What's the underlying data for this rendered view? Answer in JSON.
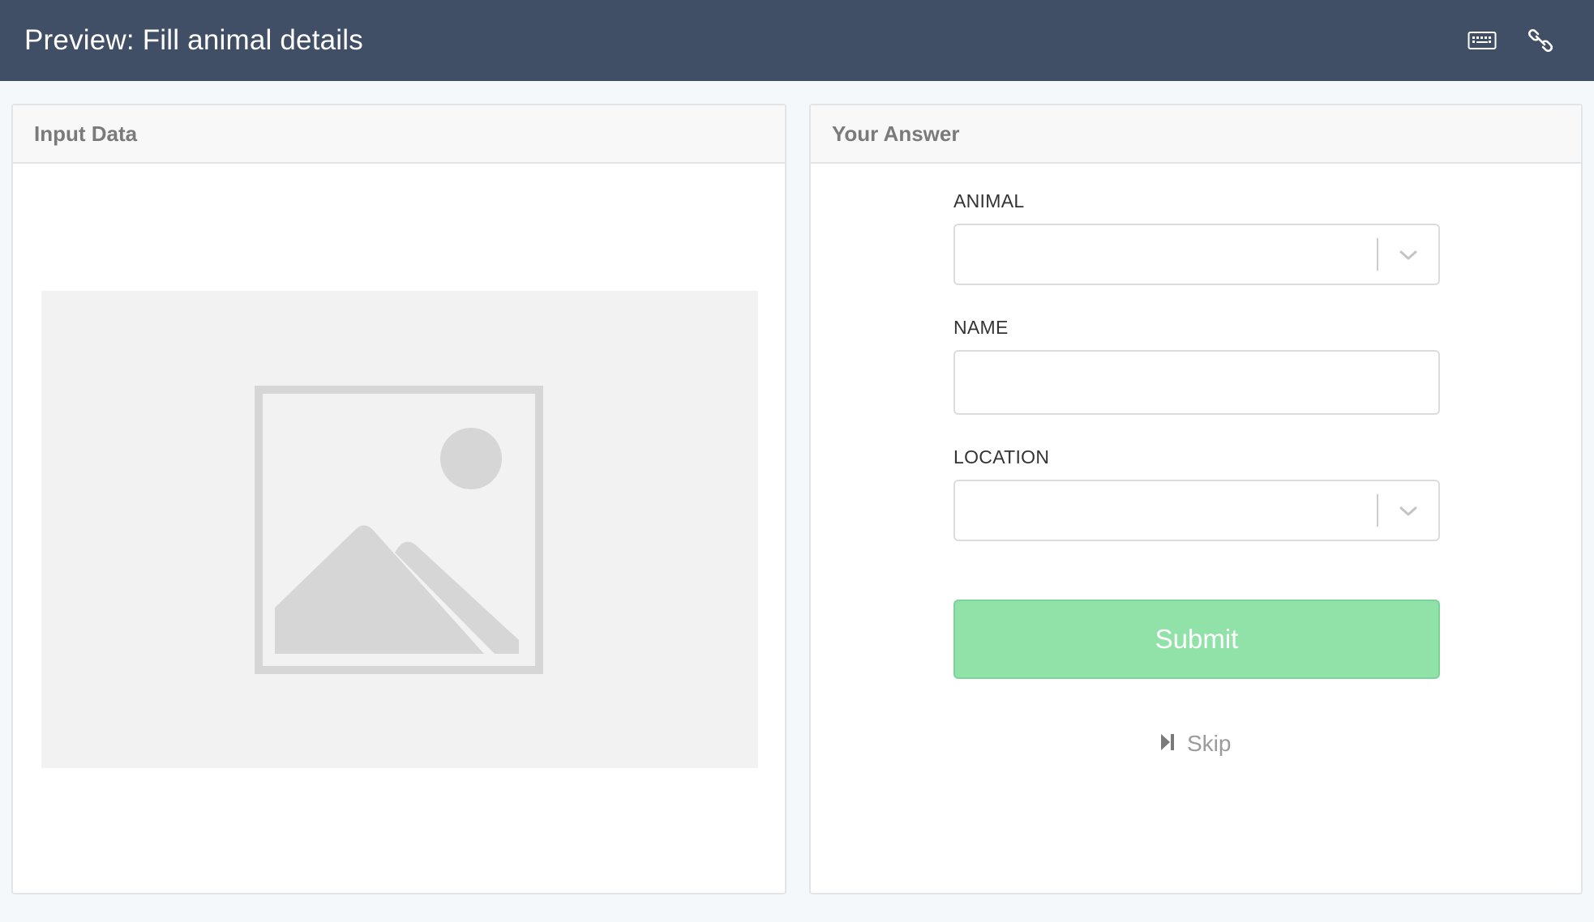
{
  "header": {
    "title": "Preview: Fill animal details",
    "background_color": "#414f66",
    "icons": [
      "keyboard-icon",
      "link-icon"
    ]
  },
  "input_panel": {
    "title": "Input Data",
    "image": "image-placeholder-icon"
  },
  "answer_panel": {
    "title": "Your Answer",
    "fields": {
      "animal": {
        "label": "ANIMAL",
        "value": "",
        "type": "select"
      },
      "name": {
        "label": "NAME",
        "value": "",
        "placeholder": "",
        "type": "text"
      },
      "location": {
        "label": "LOCATION",
        "value": "",
        "type": "select"
      }
    },
    "submit_label": "Submit",
    "submit_color": "#91e2a8",
    "skip_label": "Skip"
  }
}
